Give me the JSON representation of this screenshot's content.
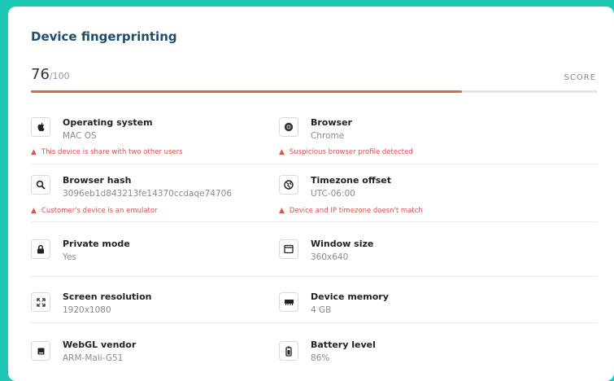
{
  "title": "Device fingerprinting",
  "score": {
    "value": "76",
    "max": "/100",
    "label": "SCORE",
    "percent": 0.76
  },
  "rows": [
    {
      "left": {
        "label": "Operating system",
        "value": "MAC OS",
        "icon": "apple-icon",
        "warning": "This device is share with two other users"
      },
      "right": {
        "label": "Browser",
        "value": "Chrome",
        "icon": "chrome-icon",
        "warning": "Suspicious browser profile detected"
      }
    },
    {
      "left": {
        "label": "Browser hash",
        "value": "3096eb1d843213fe14370ccdaqe74706",
        "icon": "search-icon",
        "warning": "Customer's device is an emulator"
      },
      "right": {
        "label": "Timezone offset",
        "value": "UTC-06:00",
        "icon": "globe-icon",
        "warning": "Device and IP timezone doesn't match"
      }
    },
    {
      "left": {
        "label": "Private mode",
        "value": "Yes",
        "icon": "lock-icon"
      },
      "right": {
        "label": "Window size",
        "value": "360x640",
        "icon": "window-icon"
      }
    },
    {
      "left": {
        "label": "Screen resolution",
        "value": "1920x1080",
        "icon": "expand-icon"
      },
      "right": {
        "label": "Device memory",
        "value": "4 GB",
        "icon": "memory-icon"
      }
    },
    {
      "left": {
        "label": "WebGL vendor",
        "value": "ARM-Mali-G51",
        "icon": "chip-icon"
      },
      "right": {
        "label": "Battery level",
        "value": "86%",
        "icon": "battery-icon"
      }
    }
  ]
}
